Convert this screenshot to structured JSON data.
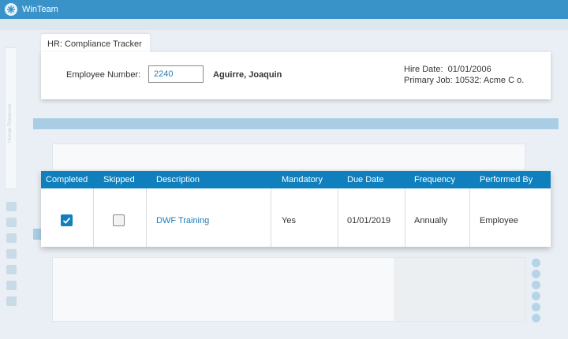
{
  "window": {
    "app_title": "WinTeam"
  },
  "background": {
    "side_panel_label": "Human Resources"
  },
  "header": {
    "tab_title": "HR: Compliance Tracker",
    "employee_number_label": "Employee Number:",
    "employee_number_value": "2240",
    "employee_name": "Aguirre, Joaquin",
    "hire_date_label": "Hire Date:",
    "hire_date_value": "01/01/2006",
    "primary_job_label": "Primary Job:",
    "primary_job_value": "10532: Acme C  o."
  },
  "table": {
    "columns": [
      "Completed",
      "Skipped",
      "Description",
      "Mandatory",
      "Due Date",
      "Frequency",
      "Performed By"
    ],
    "rows": [
      {
        "completed": true,
        "skipped": false,
        "description": "DWF Training",
        "mandatory": "Yes",
        "due_date": "01/01/2019",
        "frequency": "Annually",
        "performed_by": "Employee"
      }
    ]
  },
  "colors": {
    "titlebar": "#3a93c8",
    "table_header": "#0f7fbd",
    "link": "#1f79b7"
  }
}
